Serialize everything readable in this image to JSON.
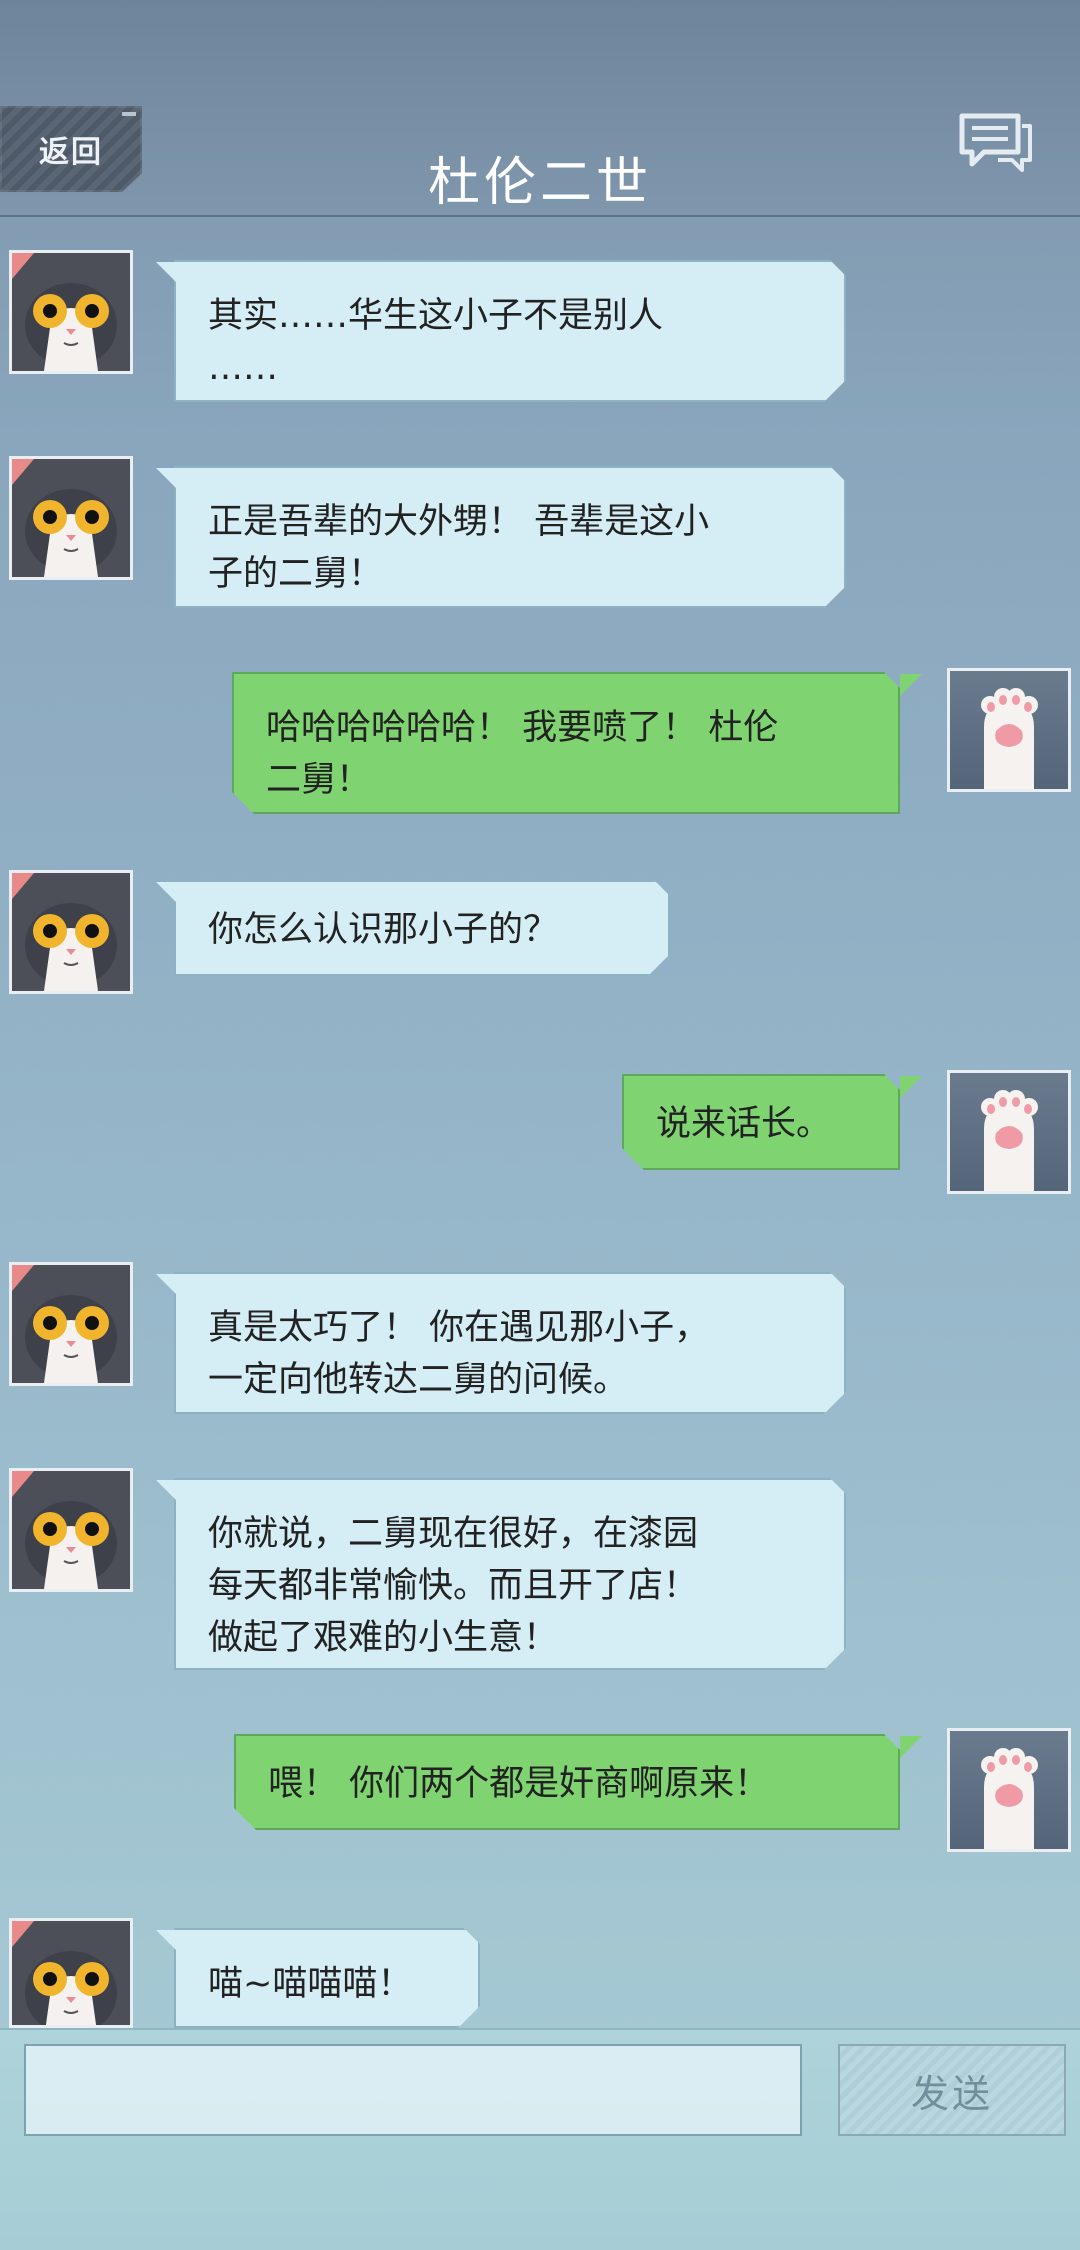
{
  "header": {
    "back_label": "返回",
    "title": "杜伦二世",
    "chat_icon": "chat-bubbles-icon"
  },
  "messages": [
    {
      "side": "left",
      "sender": "cat",
      "lines": [
        "其实……华生这小子不是别人",
        "……"
      ]
    },
    {
      "side": "left",
      "sender": "cat",
      "lines": [
        "正是吾辈的大外甥！ 吾辈是这小",
        "子的二舅！"
      ]
    },
    {
      "side": "right",
      "sender": "paw",
      "lines": [
        "哈哈哈哈哈哈！ 我要喷了！ 杜伦",
        "二舅！"
      ]
    },
    {
      "side": "left",
      "sender": "cat",
      "lines": [
        "你怎么认识那小子的？"
      ]
    },
    {
      "side": "right",
      "sender": "paw",
      "lines": [
        "说来话长。"
      ]
    },
    {
      "side": "left",
      "sender": "cat",
      "lines": [
        "真是太巧了！ 你在遇见那小子，",
        "一定向他转达二舅的问候。"
      ]
    },
    {
      "side": "left",
      "sender": "cat",
      "lines": [
        "你就说，二舅现在很好，在漆园",
        "每天都非常愉快。而且开了店！",
        "做起了艰难的小生意！"
      ]
    },
    {
      "side": "right",
      "sender": "paw",
      "lines": [
        "喂！ 你们两个都是奸商啊原来！"
      ]
    },
    {
      "side": "left",
      "sender": "cat",
      "lines": [
        "喵~喵喵喵！"
      ]
    }
  ],
  "footer": {
    "input_placeholder": "",
    "send_label": "发送"
  },
  "colors": {
    "left_bubble": "#d5eef5",
    "right_bubble": "#7fd471",
    "header": "#7489a0"
  }
}
